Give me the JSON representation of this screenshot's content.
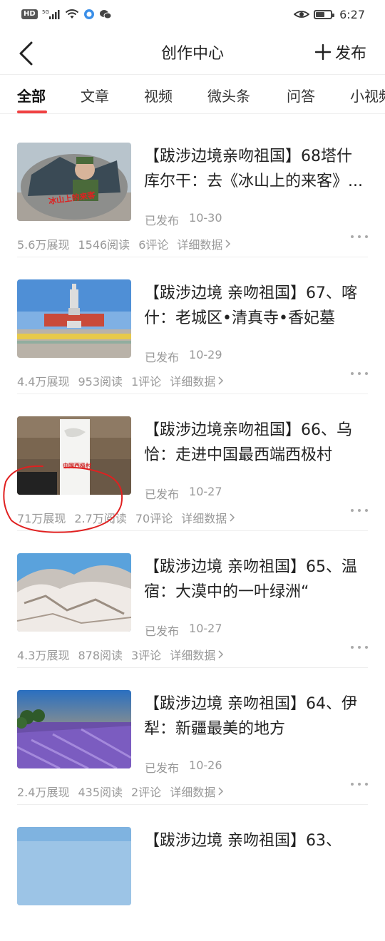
{
  "status_bar": {
    "hd": "HD",
    "signal": "5G",
    "time": "6:27",
    "battery_level": 0.6
  },
  "nav": {
    "title": "创作中心",
    "publish_label": "发布"
  },
  "tabs": [
    {
      "label": "全部",
      "active": true
    },
    {
      "label": "文章",
      "active": false
    },
    {
      "label": "视频",
      "active": false
    },
    {
      "label": "微头条",
      "active": false
    },
    {
      "label": "问答",
      "active": false
    },
    {
      "label": "小视频",
      "active": false
    }
  ],
  "articles": [
    {
      "title": "【跋涉边境亲吻祖国】68塔什库尔干：去《冰山上的来客》...",
      "status": "已发布",
      "date": "10-30",
      "views": "5.6万展现",
      "reads": "1546阅读",
      "comments": "6评论",
      "detail": "详细数据",
      "thumb_caption": "冰山上的来客"
    },
    {
      "title": "【跋涉边境 亲吻祖国】67、喀什：老城区•清真寺•香妃墓",
      "status": "已发布",
      "date": "10-29",
      "views": "4.4万展现",
      "reads": "953阅读",
      "comments": "1评论",
      "detail": "详细数据"
    },
    {
      "title": "【跋涉边境亲吻祖国】66、乌恰：走进中国最西端西极村",
      "status": "已发布",
      "date": "10-27",
      "views": "71万展现",
      "reads": "2.7万阅读",
      "comments": "70评论",
      "detail": "详细数据",
      "thumb_caption": "中国西极村"
    },
    {
      "title": "【跋涉边境 亲吻祖国】65、温宿：大漠中的一叶绿洲“",
      "status": "已发布",
      "date": "10-27",
      "views": "4.3万展现",
      "reads": "878阅读",
      "comments": "3评论",
      "detail": "详细数据"
    },
    {
      "title": "【跋涉边境 亲吻祖国】64、伊犁：新疆最美的地方",
      "status": "已发布",
      "date": "10-26",
      "views": "2.4万展现",
      "reads": "435阅读",
      "comments": "2评论",
      "detail": "详细数据"
    },
    {
      "title": "【跋涉边境 亲吻祖国】63、"
    }
  ]
}
